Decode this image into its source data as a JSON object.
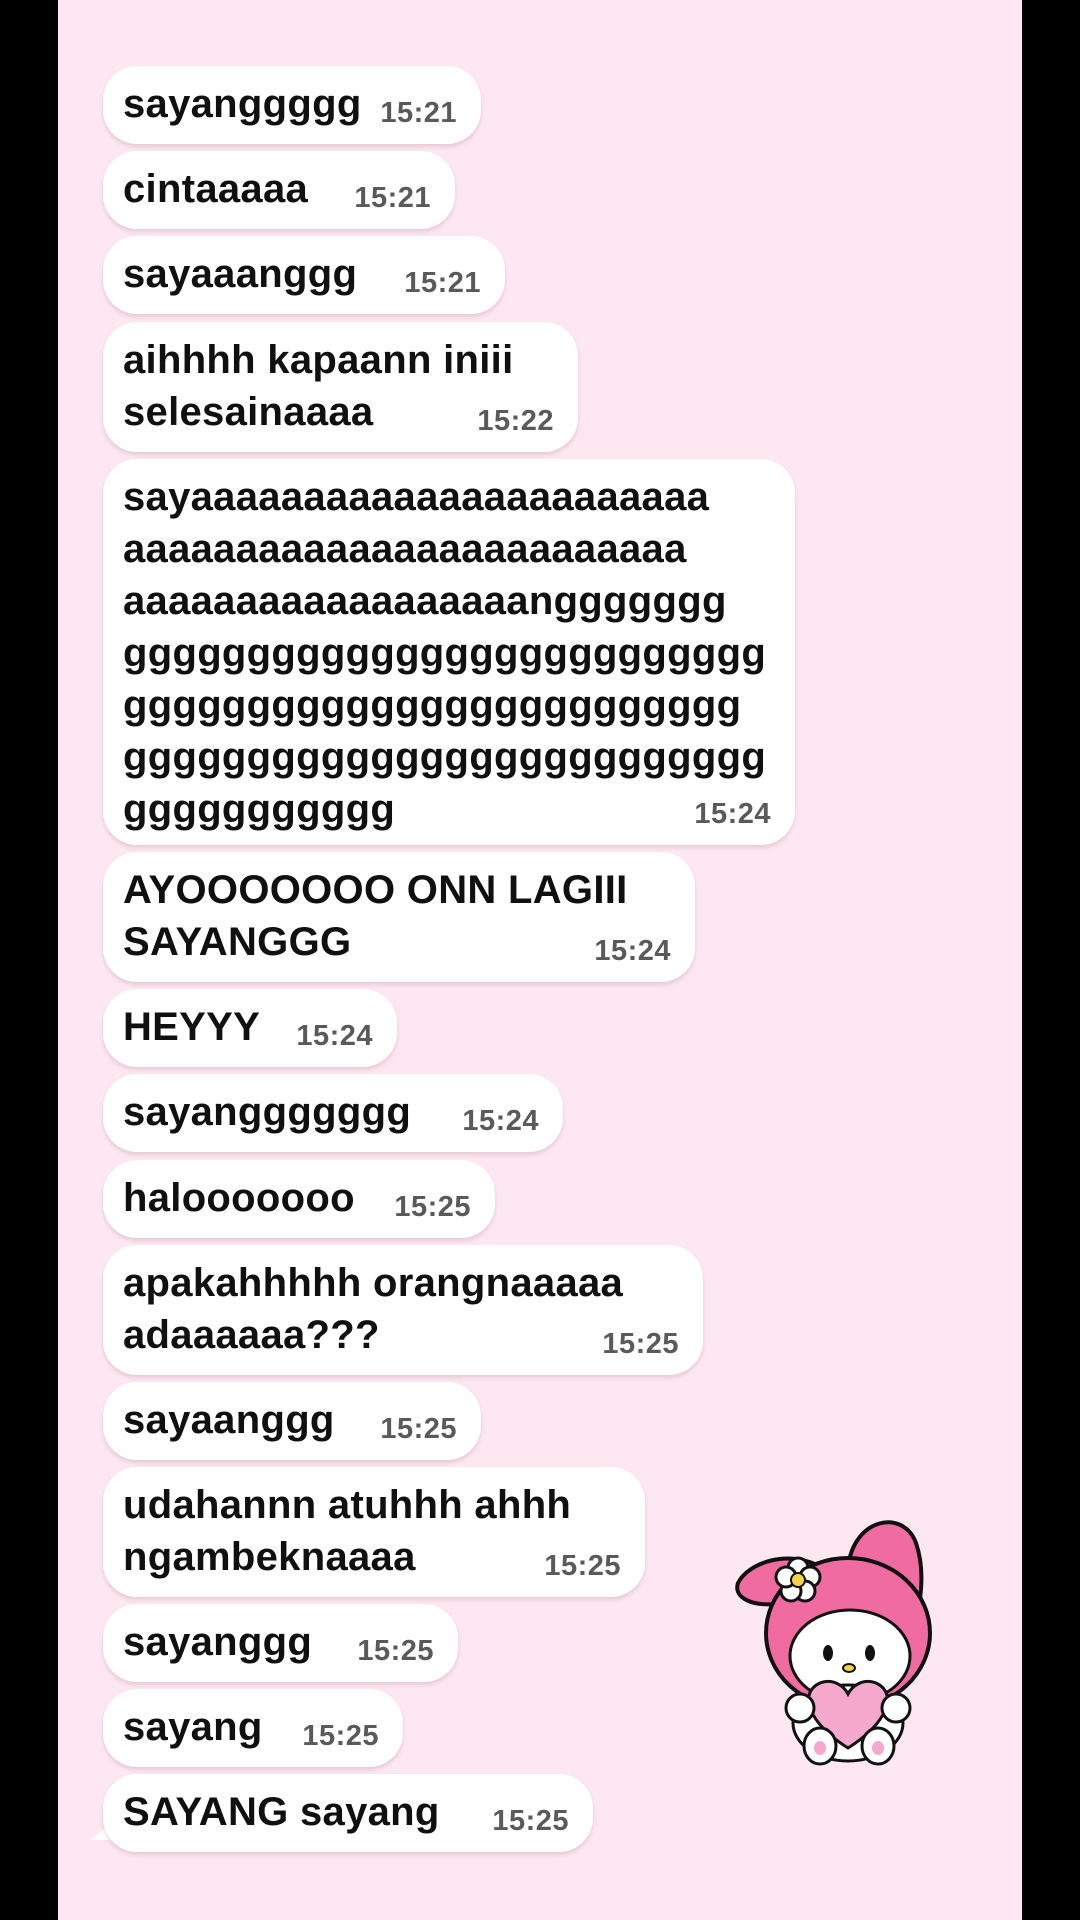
{
  "messages": [
    {
      "text": "sayanggggg",
      "time": "15:21"
    },
    {
      "text": "cintaaaaa",
      "time": "15:21"
    },
    {
      "text": "sayaaanggg",
      "time": "15:21"
    },
    {
      "text": "aihhhh kapaann iniii\nselesainaaaa",
      "time": "15:22"
    },
    {
      "text": "sayaaaaaaaaaaaaaaaaaaaaaaa\naaaaaaaaaaaaaaaaaaaaaaaaa\naaaaaaaaaaaaaaaaaanggggggg\ngggggggggggggggggggggggggg\nggggggggggggggggggggggggg\ngggggggggggggggggggggggggg\nggggggggggg",
      "time": "15:24"
    },
    {
      "text": "AYOOOOOOO ONN LAGIII\nSAYANGGG",
      "time": "15:24"
    },
    {
      "text": "HEYYY",
      "time": "15:24"
    },
    {
      "text": "sayanggggggg",
      "time": "15:24"
    },
    {
      "text": "halooooooo",
      "time": "15:25"
    },
    {
      "text": "apakahhhhh orangnaaaaa\nadaaaaaa???",
      "time": "15:25"
    },
    {
      "text": "sayaanggg",
      "time": "15:25"
    },
    {
      "text": "udahannn atuhhh ahhh\nngambeknaaaa",
      "time": "15:25"
    },
    {
      "text": "sayanggg",
      "time": "15:25"
    },
    {
      "text": "sayang",
      "time": "15:25"
    },
    {
      "text": "SAYANG sayang",
      "time": "15:25"
    }
  ],
  "sticker": {
    "icon": "my-melody-heart-sticker"
  },
  "colors": {
    "background": "#fde8f1",
    "bubble": "#ffffff",
    "text": "#101010",
    "timestamp": "#5a5a5a",
    "side_bars": "#000000"
  }
}
